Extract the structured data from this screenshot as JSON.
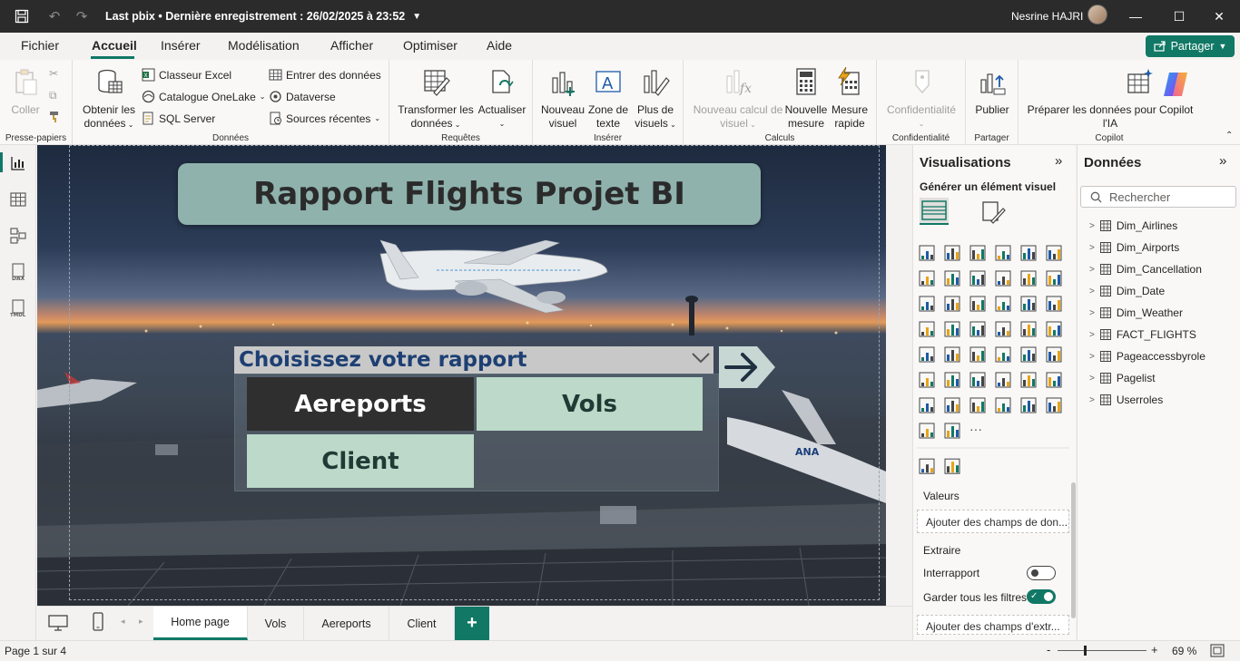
{
  "titlebar": {
    "file_title": "Last pbix • Dernière enregistrement : 26/02/2025 à 23:52",
    "user_name": "Nesrine HAJRI"
  },
  "menu": {
    "items": [
      "Fichier",
      "Accueil",
      "Insérer",
      "Modélisation",
      "Afficher",
      "Optimiser",
      "Aide"
    ],
    "share_label": "Partager"
  },
  "ribbon": {
    "clipboard": {
      "paste": "Coller",
      "group": "Presse-papiers"
    },
    "data": {
      "get_data": "Obtenir les",
      "get_data2": "données",
      "excel": "Classeur Excel",
      "onelake": "Catalogue OneLake",
      "sql": "SQL Server",
      "enter_data": "Entrer des données",
      "dataverse": "Dataverse",
      "recent": "Sources récentes",
      "group": "Données"
    },
    "queries": {
      "transform": "Transformer les",
      "transform2": "données",
      "refresh": "Actualiser",
      "group": "Requêtes"
    },
    "insert": {
      "new_visual": "Nouveau",
      "new_visual2": "visuel",
      "textbox": "Zone de",
      "textbox2": "texte",
      "more": "Plus de",
      "more2": "visuels",
      "group": "Insérer"
    },
    "calc": {
      "new_calc": "Nouveau calcul de",
      "new_calc2": "visuel",
      "new_measure": "Nouvelle",
      "new_measure2": "mesure",
      "quick_measure": "Mesure",
      "quick_measure2": "rapide",
      "group": "Calculs"
    },
    "sensitivity": {
      "label": "Confidentialité",
      "group": "Confidentialité"
    },
    "share": {
      "publish": "Publier",
      "group": "Partager"
    },
    "copilot": {
      "prepare": "Préparer les données pour Copilot",
      "prepare2": "l'IA",
      "group": "Copilot"
    }
  },
  "canvas": {
    "report_title": "Rapport Flights Projet BI",
    "selector_label": "Choisissez votre rapport",
    "buttons": [
      "Aereports",
      "Vols",
      "Client"
    ]
  },
  "page_tabs": [
    "Home page",
    "Vols",
    "Aereports",
    "Client"
  ],
  "visualizations": {
    "title": "Visualisations",
    "subtitle": "Générer un élément visuel",
    "values_label": "Valeurs",
    "values_placeholder": "Ajouter des champs de don...",
    "drillthrough_label": "Extraire",
    "cross_report": "Interrapport",
    "keep_filters": "Garder tous les filtres",
    "drill_placeholder": "Ajouter des champs d'extr..."
  },
  "data_pane": {
    "title": "Données",
    "search_placeholder": "Rechercher",
    "tables": [
      "Dim_Airlines",
      "Dim_Airports",
      "Dim_Cancellation",
      "Dim_Date",
      "Dim_Weather",
      "FACT_FLIGHTS",
      "Pageaccessbyrole",
      "Pagelist",
      "Userroles"
    ]
  },
  "status": {
    "page": "Page 1 sur 4",
    "zoom": "69 %"
  },
  "colors": {
    "accent": "#117865",
    "title_box": "#8fb2ad",
    "button_active": "#2f2f2f",
    "button_inactive": "#bcd9c9",
    "selector_text": "#1d3f73"
  }
}
